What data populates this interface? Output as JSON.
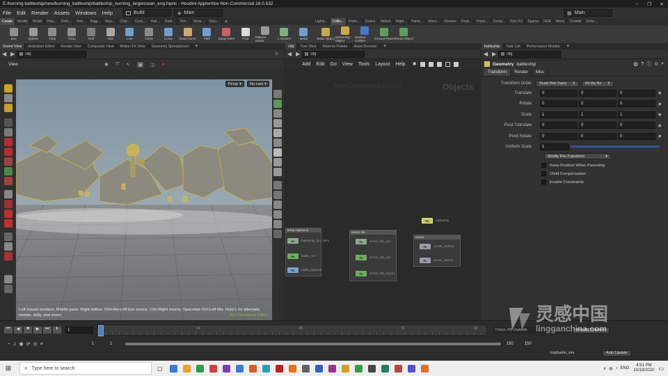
{
  "window": {
    "title": "E:/burning battleship/new/burning_battleship/battleship_burning_largeocean_eng.hipnc - Houdini Apprentice Non-Commercial 18.0.532",
    "controls": [
      "–",
      "❐",
      "✕"
    ]
  },
  "menu": {
    "items": [
      "File",
      "Edit",
      "Render",
      "Assets",
      "Windows",
      "Help"
    ],
    "build_label": "Build",
    "main_label": "Main",
    "right_main_label": "Main"
  },
  "shelf_tabs_left": [
    "Create",
    "Modify",
    "Model",
    "Poly...",
    "Defo...",
    "Text...",
    "Rigg...",
    "Mus...",
    "Char...",
    "Cons...",
    "Hair...",
    "Guid...",
    "Terr...",
    "Simp...",
    "Clou..."
  ],
  "shelf_tabs_right": [
    "Lights...",
    "Collis...",
    "Partic...",
    "Grains",
    "Vellum",
    "Rigid...",
    "Partic...",
    "Visco...",
    "Oceans",
    "Fluid...",
    "Popul...",
    "Conta...",
    "Pyro FX",
    "Sparse",
    "FEM",
    "Wires",
    "Crowds",
    "Drive..."
  ],
  "shelf_tools_left": [
    {
      "label": "Box",
      "color": "#8e8e8e"
    },
    {
      "label": "Sphere",
      "color": "#9a9a9a"
    },
    {
      "label": "Tube",
      "color": "#8a8a8a"
    },
    {
      "label": "Torus",
      "color": "#909090"
    },
    {
      "label": "Grid",
      "color": "#7e7e7e"
    },
    {
      "label": "Null",
      "color": "#a8a8a8"
    },
    {
      "label": "Line",
      "color": "#6f9fd0"
    },
    {
      "label": "Circle",
      "color": "#8a8a8a"
    },
    {
      "label": "Curve",
      "color": "#6f9fd0"
    },
    {
      "label": "Draw Curve",
      "color": "#d0a86f"
    },
    {
      "label": "Path",
      "color": "#6f9fd0"
    },
    {
      "label": "Spray Paint",
      "color": "#c86464"
    },
    {
      "label": "Font",
      "color": "#dddddd"
    },
    {
      "label": "Platonic Solids",
      "color": "#9a9a9a"
    },
    {
      "label": "L-System",
      "color": "#7fb07f"
    },
    {
      "label": "Metal",
      "color": "#6f9fd0"
    }
  ],
  "shelf_tools_right": [
    {
      "label": "Static Object",
      "color": "#c8a84a"
    },
    {
      "label": "Deforming Object",
      "color": "#c8a84a"
    },
    {
      "label": "Surface Collider",
      "color": "#4a78c8"
    },
    {
      "label": "Ground Plane",
      "color": "#5aa05a"
    },
    {
      "label": "Terrain Object",
      "color": "#5aa05a"
    }
  ],
  "viewer_tabs": [
    "Scene View",
    "Animation Editor",
    "Render View",
    "Composite View",
    "Motion FX View",
    "Geometry Spreadsheet"
  ],
  "network_tabs": [
    "/obj",
    "Tree View",
    "Material Palette",
    "Asset Browser"
  ],
  "params_tabs": [
    "battleship",
    "Take List",
    "Performance Monitor"
  ],
  "viewer": {
    "path": "obj",
    "label": "View",
    "persp": "Persp",
    "cam": "No cam",
    "hint": "Left mouse tumbles. Middle pans. Right dollies. Ctrl+Alt+Left box zooms. Ctrl+Right zooms. Spacebar-Ctrl-Left tilts. Hold L for alternate tumble, dolly, and zoom.",
    "status": "Non-Commercial Edition"
  },
  "network": {
    "path": "obj",
    "menu": [
      "Add",
      "Edit",
      "Go",
      "View",
      "Tools",
      "Layout",
      "Help"
    ],
    "watermark": "Non-Commercial Edition",
    "context": "Objects",
    "boxes": [
      {
        "title": "temp explosion",
        "nodes": [
          "battleship_fire_sim1",
          "battle_sim",
          "battle_import1"
        ]
      },
      {
        "title": "ocean fire",
        "nodes": [
          "ocean_fire_sim",
          "ocean_fire_sim",
          "ocean_fire_import"
        ]
      },
      {
        "title": "ocean",
        "nodes": [
          "ocean_surface",
          "ocean_interior"
        ]
      }
    ],
    "single_node": "battleship",
    "node_badge": "Fx"
  },
  "params": {
    "path": "obj",
    "node_type": "Geometry",
    "node_name": "battleship",
    "tabs": [
      "Transform",
      "Render",
      "Misc"
    ],
    "transform_order_label": "Transform Order",
    "transform_order": "Scale Rot Trans",
    "rot_order": "Rx Ry Rz",
    "rows": [
      {
        "label": "Translate",
        "values": [
          "0",
          "0",
          "0"
        ]
      },
      {
        "label": "Rotate",
        "values": [
          "0",
          "0",
          "0"
        ]
      },
      {
        "label": "Scale",
        "values": [
          "1",
          "1",
          "1"
        ]
      },
      {
        "label": "Pivot Translate",
        "values": [
          "0",
          "0",
          "0"
        ]
      },
      {
        "label": "Pivot Rotate",
        "values": [
          "0",
          "0",
          "0"
        ]
      }
    ],
    "uniform_scale_label": "Uniform Scale",
    "uniform_scale": "1",
    "modify_btn": "Modify Pre-Transform",
    "checks": [
      "Keep Position When Parenting",
      "Child Compensation",
      "Enable Constraints"
    ]
  },
  "timeline": {
    "frame": "1",
    "ticks": [
      "1",
      "24",
      "48",
      "72",
      "96"
    ],
    "start": "1",
    "start2": "1",
    "end": "150",
    "end2": "150",
    "keys_label": "0 keys, 0/0 channels",
    "key_all": "Key All Channels",
    "path": "/obj/battle_sim",
    "auto_update": "Auto Update"
  },
  "taskbar": {
    "search_placeholder": "Type here to search",
    "icon_colors": [
      "#3a7bd5",
      "#f0a020",
      "#2d9f4a",
      "#d04040",
      "#7a3fb0",
      "#3a7bd5",
      "#e05a20",
      "#20a0c0",
      "#c02020",
      "#f07010",
      "#606060",
      "#3060c0",
      "#a03090",
      "#d0a020",
      "#2d9f4a",
      "#444444",
      "#208060",
      "#c04040",
      "#5050d0",
      "#e07020"
    ],
    "lang": "ENG",
    "time": "4:51 PM",
    "date": "10/19/2020"
  },
  "watermark": {
    "cn": "灵感中国",
    "url": "lingganchina.com"
  }
}
